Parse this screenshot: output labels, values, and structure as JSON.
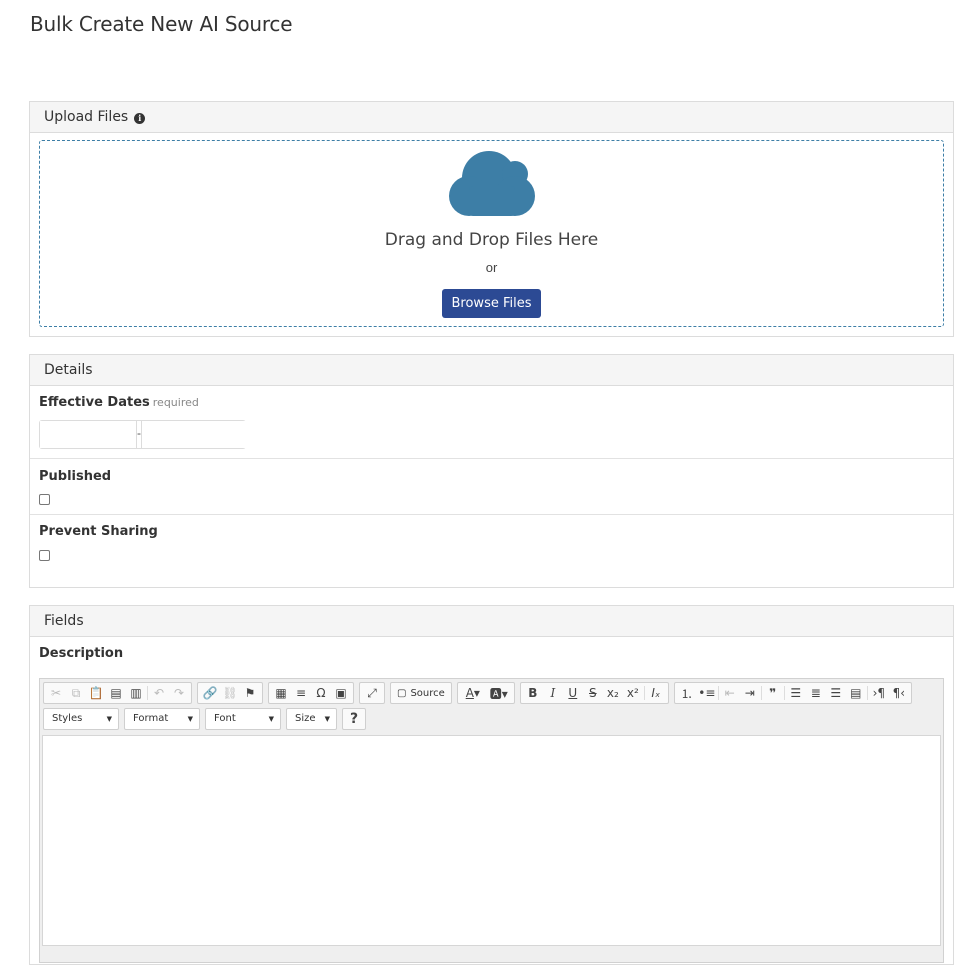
{
  "page": {
    "title": "Bulk Create New AI Source"
  },
  "upload": {
    "header": "Upload Files",
    "info_icon": "info-circle-icon",
    "cloud_icon": "cloud-icon",
    "cloud_color": "#3d7ea6",
    "drop_text": "Drag and Drop Files Here",
    "or_text": "or",
    "browse_label": "Browse Files",
    "browse_color": "#2c4a94"
  },
  "details": {
    "header": "Details",
    "effective_dates_label": "Effective Dates",
    "required_text": "required",
    "date_separator": "-",
    "start_date": "",
    "end_date": "",
    "published_label": "Published",
    "published_checked": false,
    "prevent_sharing_label": "Prevent Sharing",
    "prevent_sharing_checked": false
  },
  "fields": {
    "header": "Fields",
    "description_label": "Description",
    "editor": {
      "source_label": "Source",
      "styles_label": "Styles",
      "format_label": "Format",
      "font_label": "Font",
      "size_label": "Size",
      "help_label": "?",
      "content": ""
    }
  }
}
